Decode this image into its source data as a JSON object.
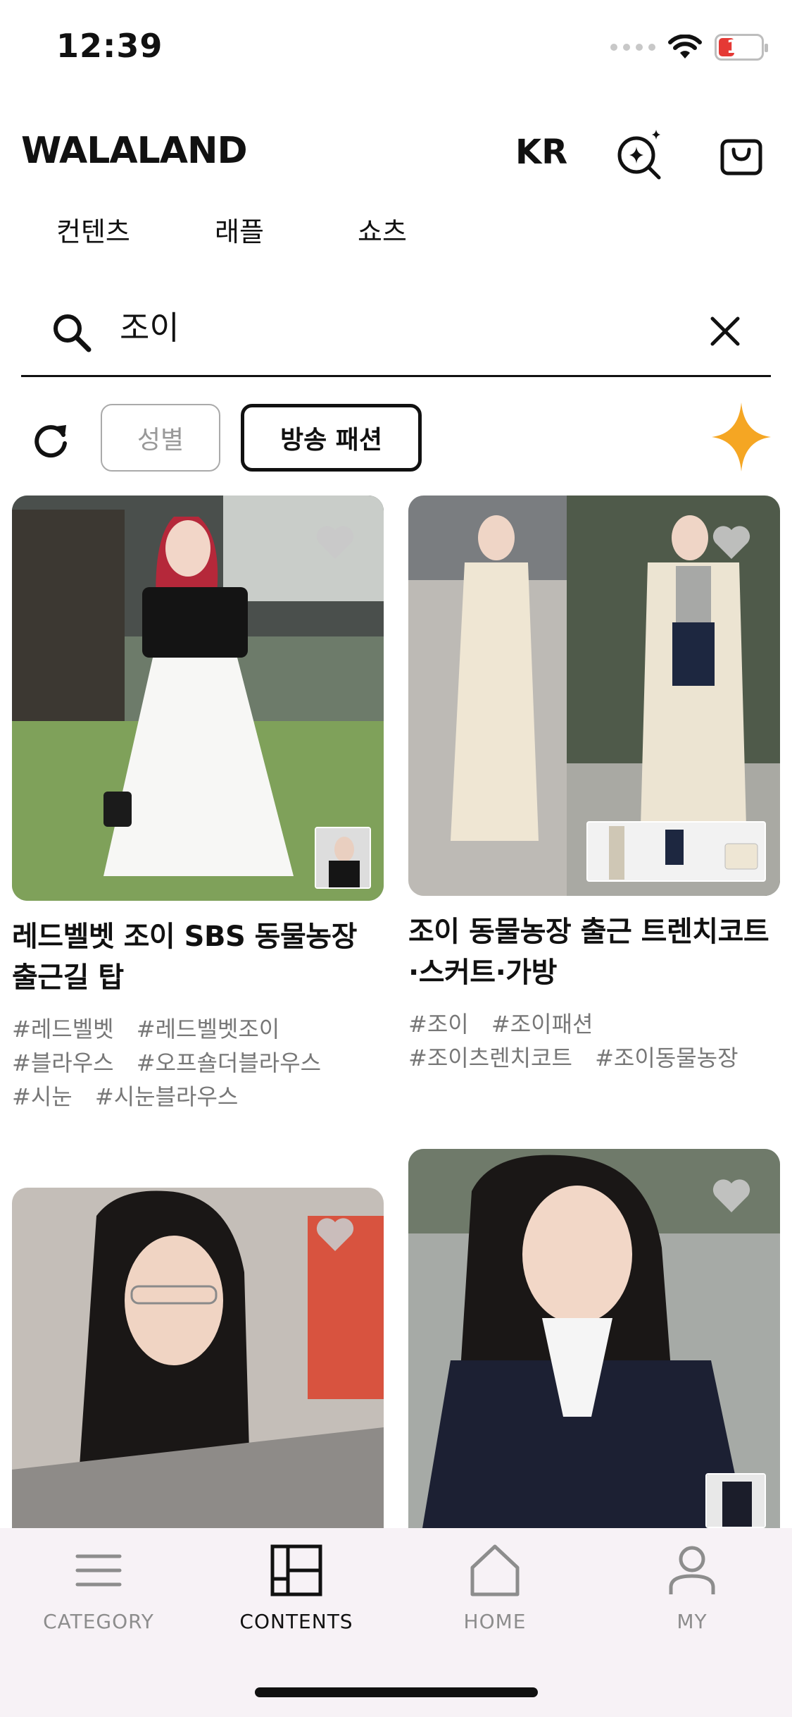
{
  "status": {
    "time": "12:39",
    "battery": "15"
  },
  "header": {
    "logo": "WALALAND",
    "lang": "KR"
  },
  "tabs": [
    {
      "label": "컨텐츠"
    },
    {
      "label": "래플"
    },
    {
      "label": "쇼츠"
    }
  ],
  "search": {
    "value": "조이",
    "placeholder": ""
  },
  "filters": {
    "gender": "성별",
    "broadcast": "방송 패션"
  },
  "cards": [
    {
      "title": "레드벨벳 조이 SBS  동물농장 출근길 탑",
      "tags": [
        "#레드벨벳",
        "#레드벨벳조이",
        "#블라우스",
        "#오프숄더블라우스",
        "#시눈",
        "#시눈블라우스"
      ]
    },
    {
      "title": "조이 동물농장 출근 트렌치코트 ·스커트·가방",
      "tags": [
        "#조이",
        "#조이패션",
        "#조이츠렌치코트",
        "#조이동물농장"
      ]
    },
    {
      "title": "",
      "tags": []
    },
    {
      "title": "",
      "tags": []
    }
  ],
  "nav": [
    {
      "label": "CATEGORY",
      "icon": "menu-icon"
    },
    {
      "label": "CONTENTS",
      "icon": "grid-layout-icon"
    },
    {
      "label": "HOME",
      "icon": "home-icon"
    },
    {
      "label": "MY",
      "icon": "user-icon"
    }
  ],
  "colors": {
    "accent_sparkle": "#f5a623",
    "battery_low": "#e53935",
    "nav_bg": "#f7f2f6"
  }
}
